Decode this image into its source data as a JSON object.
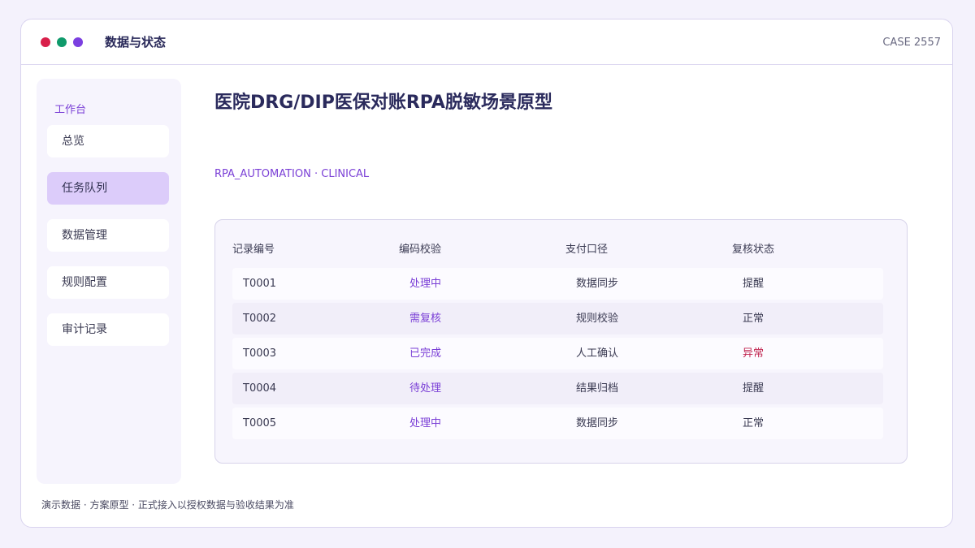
{
  "window": {
    "title": "数据与状态",
    "case_id": "CASE 2557",
    "dot_colors": [
      "#d81f4a",
      "#0f9a6b",
      "#7b3fe0"
    ]
  },
  "sidebar": {
    "heading": "工作台",
    "items": [
      {
        "label": "总览",
        "active": false
      },
      {
        "label": "任务队列",
        "active": true
      },
      {
        "label": "数据管理",
        "active": false
      },
      {
        "label": "规则配置",
        "active": false
      },
      {
        "label": "审计记录",
        "active": false
      }
    ]
  },
  "main": {
    "title": "医院DRG/DIP医保对账RPA脱敏场景原型",
    "tags": "RPA_AUTOMATION · CLINICAL",
    "table": {
      "headers": [
        "记录编号",
        "编码校验",
        "支付口径",
        "复核状态"
      ],
      "rows": [
        {
          "id": "T0001",
          "code_check": "处理中",
          "payment": "数据同步",
          "status": "提醒"
        },
        {
          "id": "T0002",
          "code_check": "需复核",
          "payment": "规则校验",
          "status": "正常"
        },
        {
          "id": "T0003",
          "code_check": "已完成",
          "payment": "人工确认",
          "status": "异常"
        },
        {
          "id": "T0004",
          "code_check": "待处理",
          "payment": "结果归档",
          "status": "提醒"
        },
        {
          "id": "T0005",
          "code_check": "处理中",
          "payment": "数据同步",
          "status": "正常"
        }
      ]
    }
  },
  "footer": {
    "note": "演示数据 · 方案原型 · 正式接入以授权数据与验收结果为准"
  },
  "colors": {
    "accent": "#7a3fd6",
    "alert": "#c0244f",
    "active_nav": "#dcccfa"
  }
}
